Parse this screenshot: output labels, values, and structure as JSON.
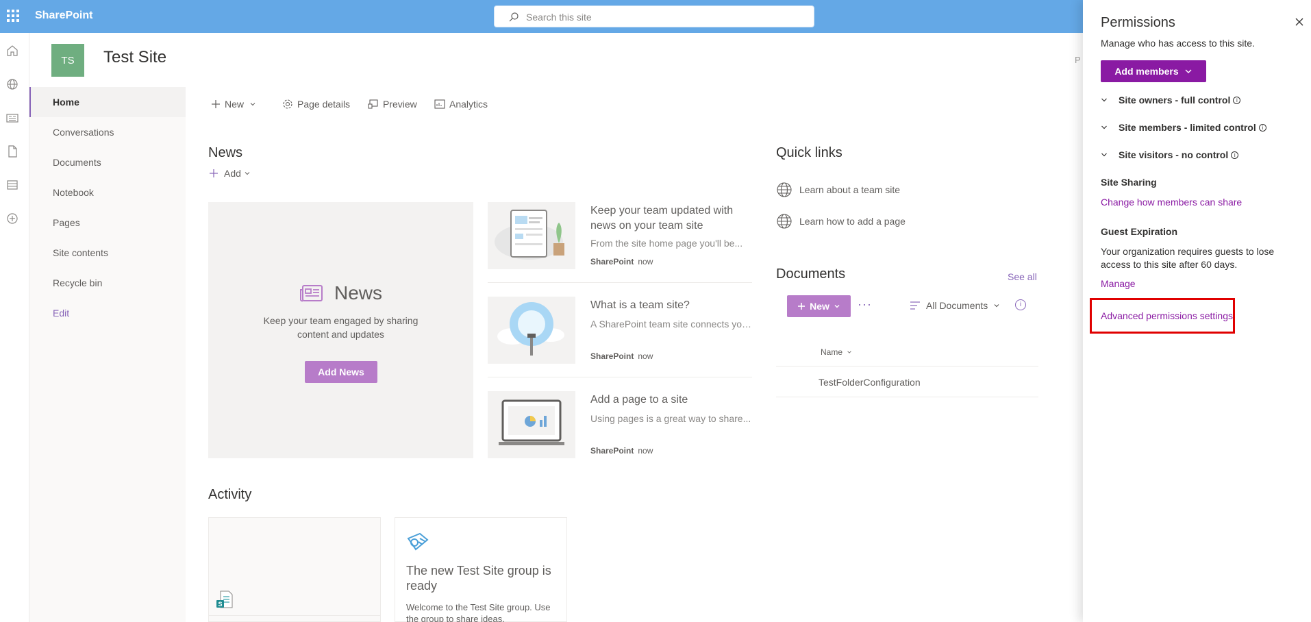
{
  "suite": {
    "brand": "SharePoint",
    "search_placeholder": "Search this site"
  },
  "site": {
    "logo_initials": "TS",
    "title": "Test Site"
  },
  "nav": {
    "items": [
      {
        "label": "Home",
        "active": true
      },
      {
        "label": "Conversations"
      },
      {
        "label": "Documents"
      },
      {
        "label": "Notebook"
      },
      {
        "label": "Pages"
      },
      {
        "label": "Site contents"
      },
      {
        "label": "Recycle bin"
      }
    ],
    "edit": "Edit"
  },
  "commands": {
    "new": "New",
    "page_details": "Page details",
    "preview": "Preview",
    "analytics": "Analytics"
  },
  "news": {
    "title": "News",
    "add": "Add",
    "hero": {
      "title": "News",
      "text": "Keep your team engaged by sharing content and updates",
      "button": "Add News"
    },
    "cards": [
      {
        "title": "Keep your team updated with news on your team site",
        "desc": "From the site home page you'll be...",
        "source": "SharePoint",
        "time": "now"
      },
      {
        "title": "What is a team site?",
        "desc": "A SharePoint team site connects you...",
        "source": "SharePoint",
        "time": "now"
      },
      {
        "title": "Add a page to a site",
        "desc": "Using pages is a great way to share...",
        "source": "SharePoint",
        "time": "now"
      }
    ]
  },
  "quick_links": {
    "title": "Quick links",
    "items": [
      "Learn about a team site",
      "Learn how to add a page"
    ]
  },
  "documents": {
    "title": "Documents",
    "see_all": "See all",
    "new": "New",
    "more": "···",
    "view": "All Documents",
    "info": "i",
    "column_name": "Name",
    "rows": [
      "TestFolderConfiguration"
    ]
  },
  "activity": {
    "title": "Activity",
    "group_card": {
      "title": "The new Test Site group is ready",
      "desc": "Welcome to the Test Site group. Use the group to share ideas,"
    }
  },
  "panel": {
    "title": "Permissions",
    "subtitle": "Manage who has access to this site.",
    "add_members": "Add members",
    "groups": [
      "Site owners - full control",
      "Site members - limited control",
      "Site visitors - no control"
    ],
    "info": "i",
    "site_sharing": {
      "heading": "Site Sharing",
      "link": "Change how members can share"
    },
    "guest_expiration": {
      "heading": "Guest Expiration",
      "text": "Your organization requires guests to lose access to this site after 60 days.",
      "link": "Manage"
    },
    "advanced_link": "Advanced permissions settings"
  },
  "background_edge_letter": "P",
  "colors": {
    "suite_bar": "#64a8e6",
    "accent": "#8a1aa3",
    "theme_purple": "#b77cc9",
    "site_logo": "#6fae80",
    "highlight": "#e00000"
  }
}
